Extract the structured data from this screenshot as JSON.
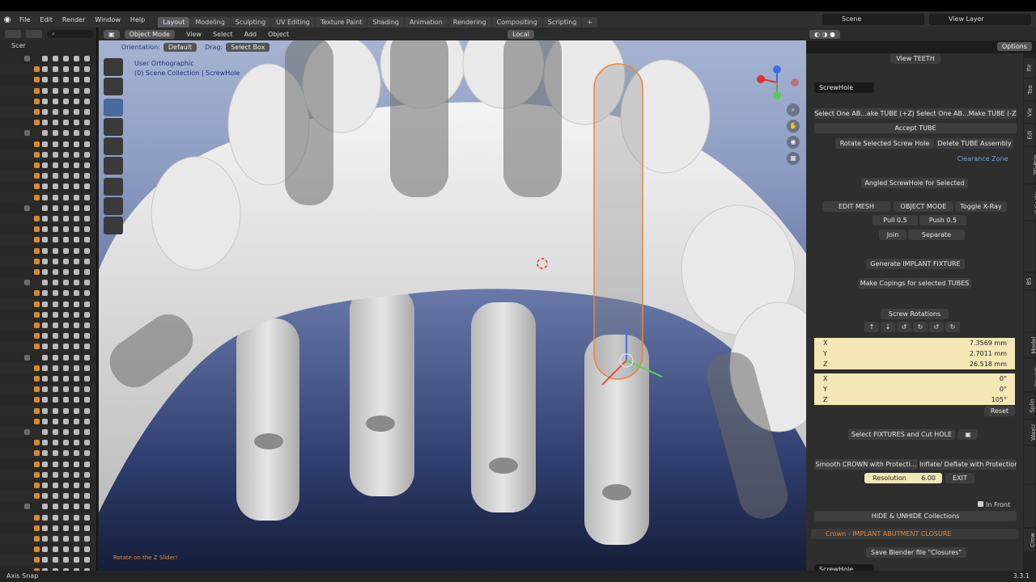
{
  "menu": {
    "items": [
      "File",
      "Edit",
      "Render",
      "Window",
      "Help"
    ]
  },
  "workspaces": [
    "Layout",
    "Modeling",
    "Sculpting",
    "UV Editing",
    "Texture Paint",
    "Shading",
    "Animation",
    "Rendering",
    "Compositing",
    "Scripting"
  ],
  "scene": {
    "name": "Scene",
    "view_layer": "View Layer"
  },
  "outliner": {
    "root": "Scer"
  },
  "viewport_header": {
    "mode": "Object Mode",
    "menus": [
      "View",
      "Select",
      "Add",
      "Object"
    ],
    "transform_orientation": "Local",
    "orientation_label": "Orientation:",
    "orientation_value": "Default",
    "drag_label": "Drag:",
    "drag_value": "Select Box",
    "options": "Options"
  },
  "viewport": {
    "view_name": "User Orthographic",
    "collection": "(0) Scene Collection | ScrewHole",
    "hint": "Rotate on the Z Slider!"
  },
  "panel": {
    "view_teeth": "View TEETH",
    "object_name": "ScrewHole",
    "select_tube_plus": "Select One AB...ake TUBE (+Z)",
    "select_tube_minus": "Select One AB...Make TUBE (-Z)",
    "accept_tube": "Accept TUBE",
    "rotate_screw": "Rotate Selected Screw Hole",
    "delete_tube": "Delete TUBE Assembly",
    "clearance_zone": "Clearance Zone",
    "angled_screwhole": "Angled ScrewHole for Selected",
    "edit_mesh": "EDIT MESH",
    "object_mode": "OBJECT MODE",
    "toggle_xray": "Toggle X-Ray",
    "pull": "Pull 0.5",
    "push": "Push 0.5",
    "join": "Join",
    "separate": "Separate",
    "generate_fixture": "Generate IMPLANT FIXTURE",
    "make_copings": "Make Copings for selected TUBES",
    "screw_rotations": "Screw Rotations",
    "location": [
      {
        "axis": "X",
        "value": "7.3569 mm"
      },
      {
        "axis": "Y",
        "value": "2.7011 mm"
      },
      {
        "axis": "Z",
        "value": "26.518 mm"
      }
    ],
    "rotation": [
      {
        "axis": "X",
        "value": "0°"
      },
      {
        "axis": "Y",
        "value": "0°"
      },
      {
        "axis": "Z",
        "value": "105°"
      }
    ],
    "reset": "Reset",
    "select_fixtures": "Select FIXTURES and Cut HOLE",
    "smooth_crown": "Smooth CROWN with Protecti...",
    "inflate_deflate": "Inflate/ Deflate with Protection",
    "resolution_label": "Resolution",
    "resolution_value": "6.00",
    "exit": "EXIT",
    "in_front": "In Front",
    "hide_unhide": "HIDE & UNHIDE Collections",
    "crown_section": "Crown - IMPLANT  ABUTMENT CLOSURE",
    "save_blender": "Save Blender file \"Closures\"",
    "bottom_label": "ScrewHole"
  },
  "side_tabs": [
    "Ite",
    "Too",
    "Vie",
    "Edi",
    "3D-Prin",
    "C-Sectio",
    "ICP Registratio",
    "BS",
    "Attachment",
    "Model",
    "BlockOu",
    "Splin",
    "WaxU",
    "Articulato",
    "Component",
    "Crow"
  ],
  "status": {
    "left": "Axis Snap",
    "version": "3.3.1"
  },
  "colors": {
    "accent": "#4772b3",
    "field_bg": "#f2e7b5",
    "selection": "#e8873a"
  }
}
